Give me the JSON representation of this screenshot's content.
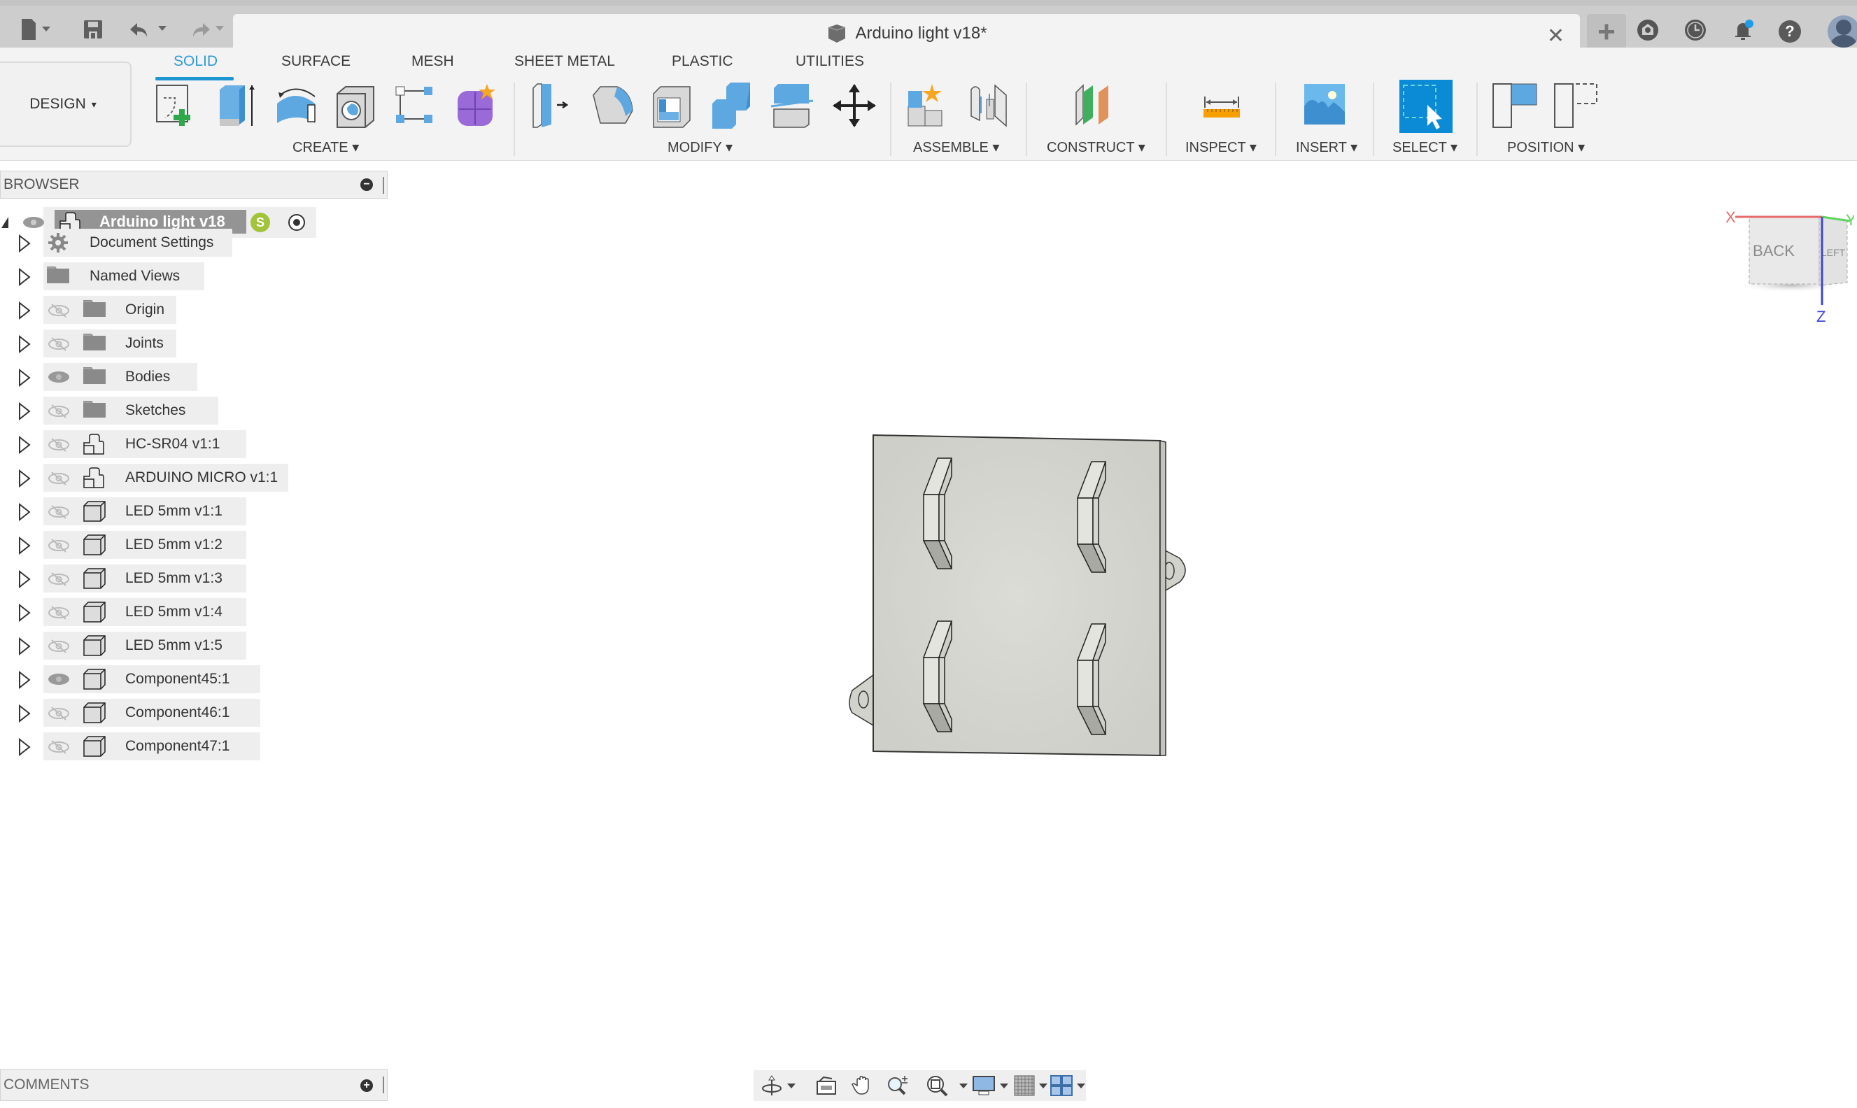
{
  "titlebar": {
    "document_title": "Arduino light v18*",
    "quick_access": [
      {
        "name": "file-menu",
        "icon": "file-icon"
      },
      {
        "name": "save",
        "icon": "save-icon"
      },
      {
        "name": "undo",
        "icon": "undo-icon"
      },
      {
        "name": "redo",
        "icon": "redo-icon"
      }
    ],
    "close_symbol": "✕",
    "new_tab_symbol": "+",
    "right_icons": [
      "extensions-icon",
      "job-status-icon",
      "notifications-icon",
      "help-icon",
      "profile-avatar"
    ],
    "help_symbol": "?",
    "notification_dot_color": "#1e9be9"
  },
  "workspace": {
    "label": "DESIGN",
    "caret": "▾"
  },
  "ribbon": {
    "tabs": [
      "SOLID",
      "SURFACE",
      "MESH",
      "SHEET METAL",
      "PLASTIC",
      "UTILITIES"
    ],
    "active_tab": "SOLID",
    "groups": [
      {
        "label": "CREATE ▾",
        "tools": [
          "create-sketch",
          "extrude",
          "revolve",
          "hole",
          "pattern",
          "create-form"
        ]
      },
      {
        "label": "MODIFY ▾",
        "tools": [
          "press-pull",
          "fillet",
          "shell",
          "combine",
          "split-body",
          "move-copy"
        ]
      },
      {
        "label": "ASSEMBLE ▾",
        "tools": [
          "new-component",
          "joint"
        ]
      },
      {
        "label": "CONSTRUCT ▾",
        "tools": [
          "offset-plane"
        ]
      },
      {
        "label": "INSPECT ▾",
        "tools": [
          "measure"
        ]
      },
      {
        "label": "INSERT ▾",
        "tools": [
          "insert-image"
        ]
      },
      {
        "label": "SELECT ▾",
        "tools": [
          "select"
        ]
      },
      {
        "label": "POSITION ▾",
        "tools": [
          "capture-position",
          "revert-position"
        ]
      }
    ],
    "accent_color": "#1e96d2"
  },
  "browser": {
    "title": "BROWSER",
    "collapse_symbol": "−",
    "root": {
      "label": "Arduino light v18",
      "badge": "S"
    },
    "items": [
      {
        "label": "Document Settings",
        "icon": "gear",
        "eye": "none"
      },
      {
        "label": "Named Views",
        "icon": "folder",
        "eye": "none"
      },
      {
        "label": "Origin",
        "icon": "folder",
        "eye": "hidden"
      },
      {
        "label": "Joints",
        "icon": "folder",
        "eye": "hidden"
      },
      {
        "label": "Bodies",
        "icon": "folder",
        "eye": "visible"
      },
      {
        "label": "Sketches",
        "icon": "folder",
        "eye": "hidden"
      },
      {
        "label": "HC-SR04 v1:1",
        "icon": "assembly",
        "eye": "hidden"
      },
      {
        "label": "ARDUINO MICRO v1:1",
        "icon": "assembly",
        "eye": "hidden"
      },
      {
        "label": "LED 5mm v1:1",
        "icon": "component",
        "eye": "hidden"
      },
      {
        "label": "LED 5mm v1:2",
        "icon": "component",
        "eye": "hidden"
      },
      {
        "label": "LED 5mm v1:3",
        "icon": "component",
        "eye": "hidden"
      },
      {
        "label": "LED 5mm v1:4",
        "icon": "component",
        "eye": "hidden"
      },
      {
        "label": "LED 5mm v1:5",
        "icon": "component",
        "eye": "hidden"
      },
      {
        "label": "Component45:1",
        "icon": "component",
        "eye": "visible"
      },
      {
        "label": "Component46:1",
        "icon": "component",
        "eye": "hidden"
      },
      {
        "label": "Component47:1",
        "icon": "component",
        "eye": "hidden"
      }
    ]
  },
  "comments": {
    "title": "COMMENTS",
    "add_symbol": "+"
  },
  "viewcube": {
    "faces": [
      "BACK",
      "LEFT"
    ],
    "axes": {
      "x": "X",
      "y": "Y",
      "z": "Z"
    },
    "axis_colors": {
      "x": "#e86a6a",
      "y": "#5fd35f",
      "z": "#3c46d6"
    }
  },
  "navbar": {
    "tools": [
      "orbit",
      "look-at",
      "pan",
      "zoom",
      "fit",
      "display-settings",
      "grid-snaps",
      "viewports"
    ]
  }
}
